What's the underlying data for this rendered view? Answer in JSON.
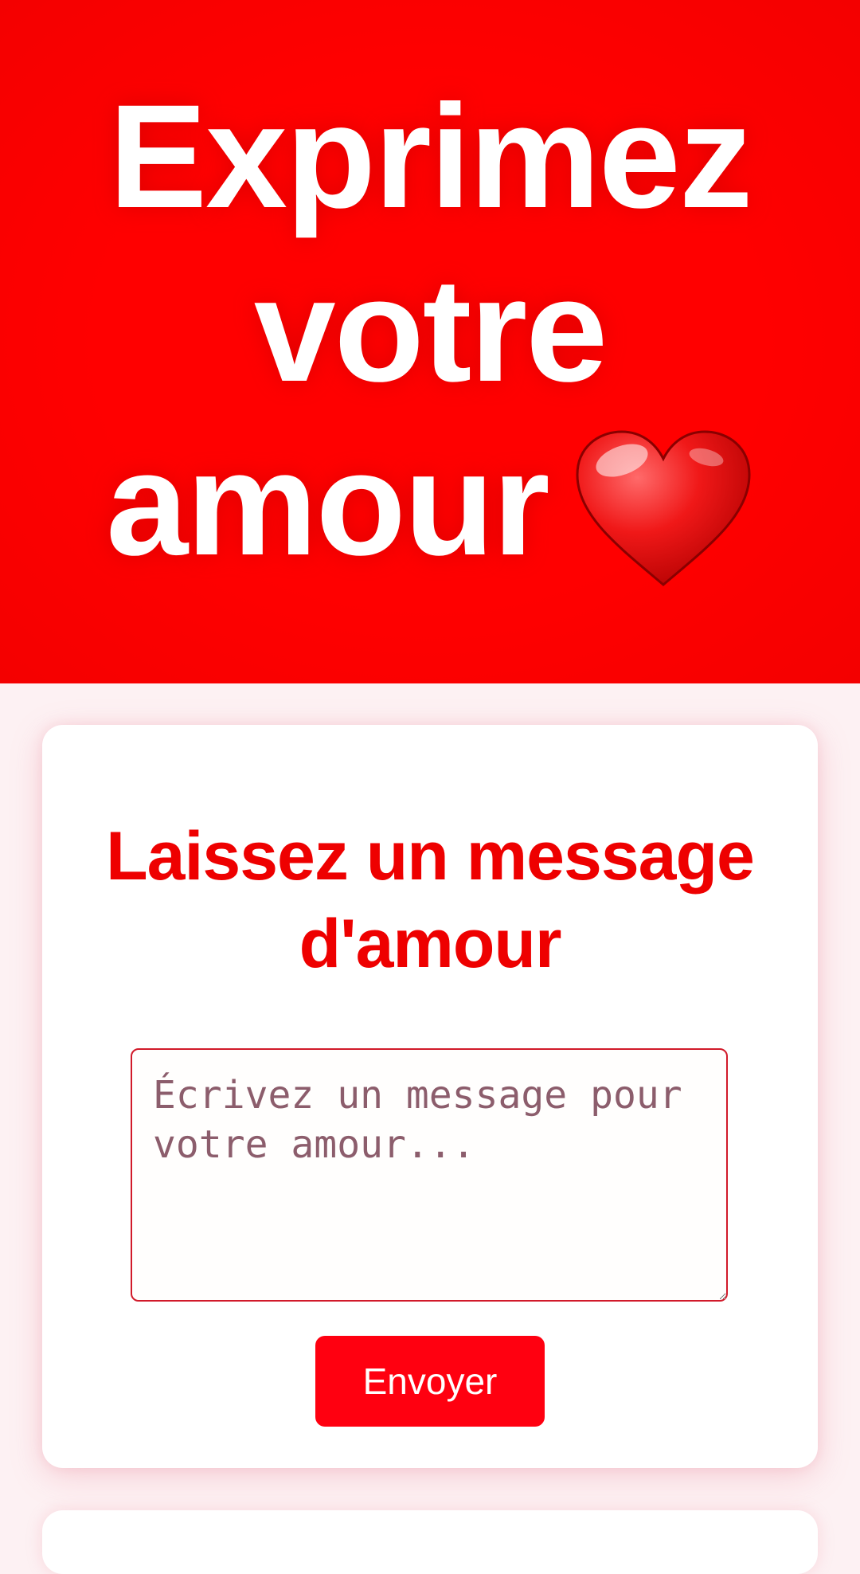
{
  "hero": {
    "line1": "Exprimez",
    "line2": "votre",
    "line3": "amour",
    "heart_icon": "red-heart-emoji",
    "background_color": "#ff0000"
  },
  "message_card": {
    "title": "Laissez un message d'amour",
    "textarea": {
      "value": "",
      "placeholder": "Écrivez un message pour votre amour..."
    },
    "send_label": "Envoyer",
    "accent_color": "#ee0000"
  }
}
